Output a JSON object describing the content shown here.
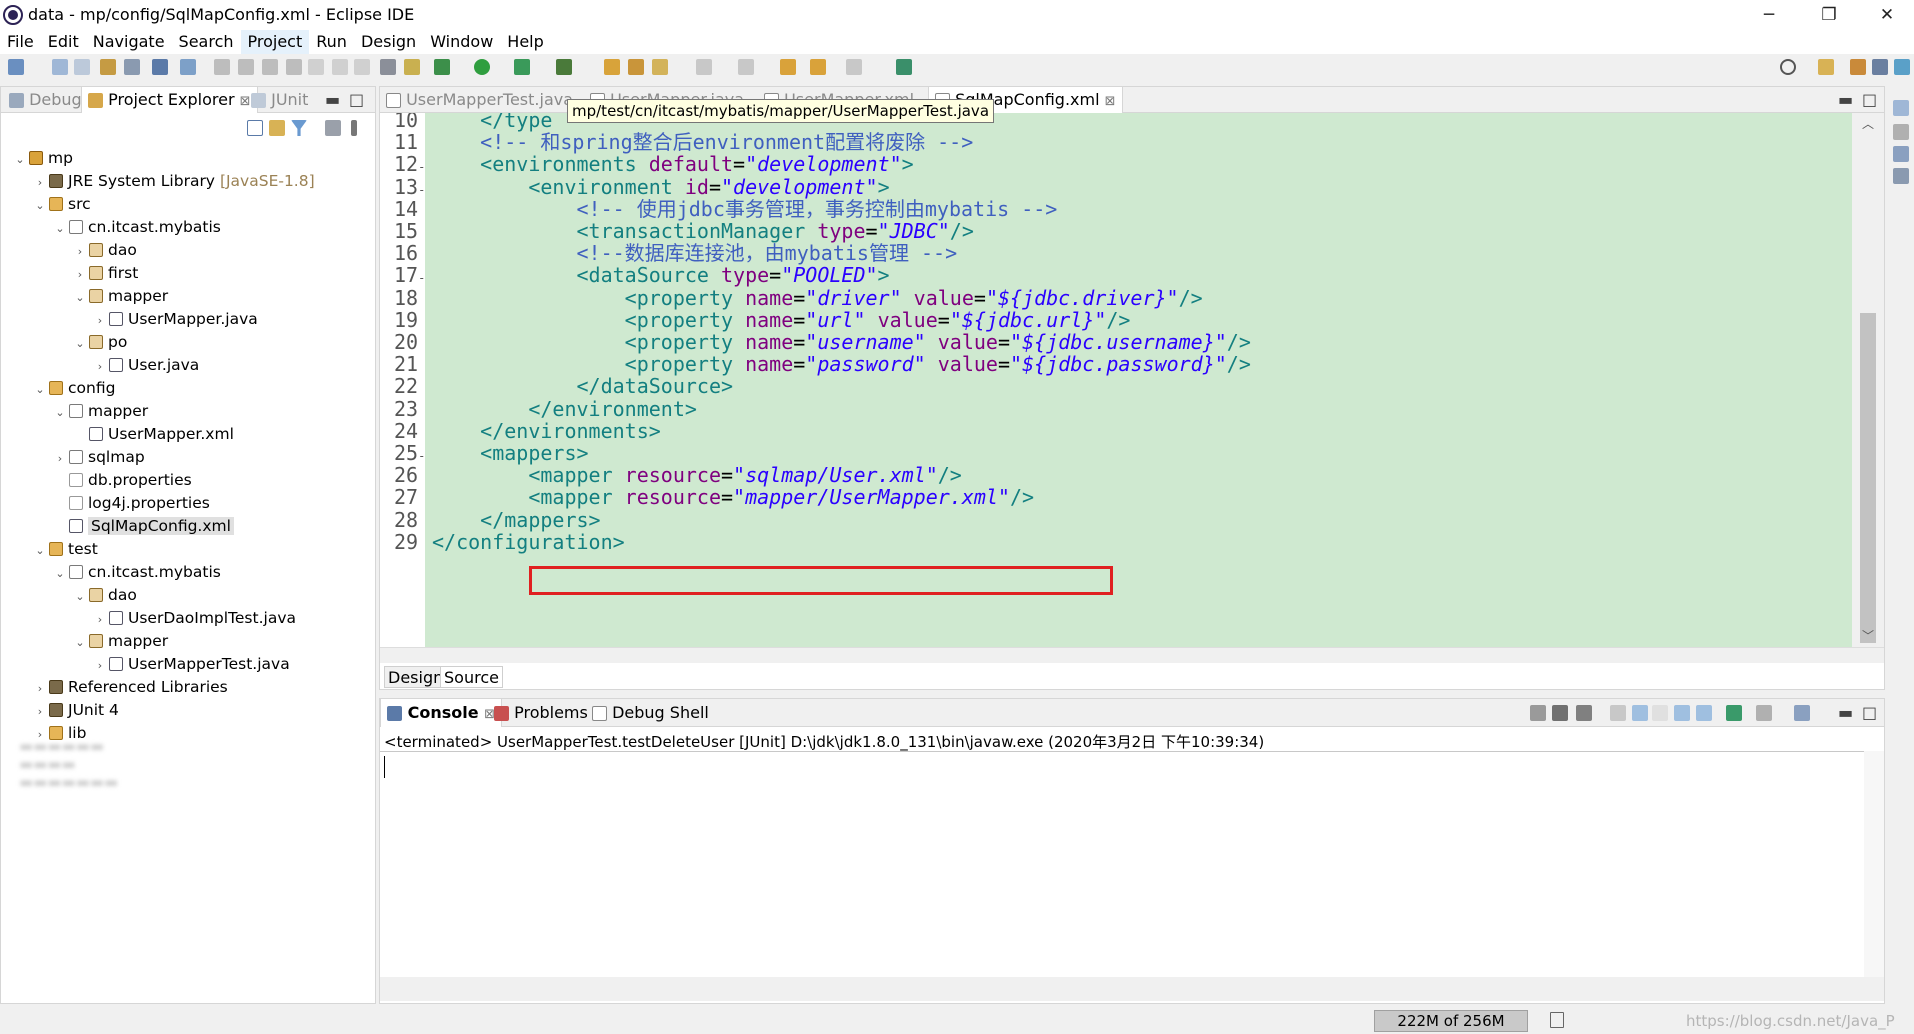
{
  "window": {
    "title": "data - mp/config/SqlMapConfig.xml - Eclipse IDE",
    "minimize": "─",
    "restore": "❐",
    "close": "✕"
  },
  "menu": [
    "File",
    "Edit",
    "Navigate",
    "Search",
    "Project",
    "Run",
    "Design",
    "Window",
    "Help"
  ],
  "left_view": {
    "tabs": {
      "debug": "Debug",
      "explorer": "Project Explorer",
      "junit": "JUnit"
    },
    "tree": [
      {
        "label": "mp",
        "sub": "",
        "depth": 0,
        "arrow": "v",
        "icon": "project-icon",
        "cls": "proj"
      },
      {
        "label": "JRE System Library",
        "sub": "[JavaSE-1.8]",
        "depth": 1,
        "arrow": ">",
        "icon": "library-icon",
        "cls": "lib"
      },
      {
        "label": "src",
        "sub": "",
        "depth": 1,
        "arrow": "v",
        "icon": "source-folder-icon",
        "cls": "src"
      },
      {
        "label": "cn.itcast.mybatis",
        "sub": "",
        "depth": 2,
        "arrow": "v",
        "icon": "package-icon",
        "cls": "pkg"
      },
      {
        "label": "dao",
        "sub": "",
        "depth": 3,
        "arrow": ">",
        "icon": "package-icon",
        "cls": "pkgc"
      },
      {
        "label": "first",
        "sub": "",
        "depth": 3,
        "arrow": ">",
        "icon": "package-icon",
        "cls": "pkgc"
      },
      {
        "label": "mapper",
        "sub": "",
        "depth": 3,
        "arrow": "v",
        "icon": "package-icon",
        "cls": "pkgc"
      },
      {
        "label": "UserMapper.java",
        "sub": "",
        "depth": 4,
        "arrow": ">",
        "icon": "java-file-icon",
        "cls": "java"
      },
      {
        "label": "po",
        "sub": "",
        "depth": 3,
        "arrow": "v",
        "icon": "package-icon",
        "cls": "pkgc"
      },
      {
        "label": "User.java",
        "sub": "",
        "depth": 4,
        "arrow": ">",
        "icon": "java-file-icon",
        "cls": "java"
      },
      {
        "label": "config",
        "sub": "",
        "depth": 1,
        "arrow": "v",
        "icon": "source-folder-icon",
        "cls": "src"
      },
      {
        "label": "mapper",
        "sub": "",
        "depth": 2,
        "arrow": "v",
        "icon": "package-icon",
        "cls": "pkg"
      },
      {
        "label": "UserMapper.xml",
        "sub": "",
        "depth": 3,
        "arrow": "",
        "icon": "xml-file-icon",
        "cls": "xml"
      },
      {
        "label": "sqlmap",
        "sub": "",
        "depth": 2,
        "arrow": ">",
        "icon": "package-icon",
        "cls": "pkg"
      },
      {
        "label": "db.properties",
        "sub": "",
        "depth": 2,
        "arrow": "",
        "icon": "file-icon",
        "cls": "file"
      },
      {
        "label": "log4j.properties",
        "sub": "",
        "depth": 2,
        "arrow": "",
        "icon": "file-icon",
        "cls": "file"
      },
      {
        "label": "SqlMapConfig.xml",
        "sub": "",
        "depth": 2,
        "arrow": "",
        "icon": "xml-file-icon",
        "cls": "xml",
        "selected": true
      },
      {
        "label": "test",
        "sub": "",
        "depth": 1,
        "arrow": "v",
        "icon": "source-folder-icon",
        "cls": "src"
      },
      {
        "label": "cn.itcast.mybatis",
        "sub": "",
        "depth": 2,
        "arrow": "v",
        "icon": "package-icon",
        "cls": "pkg"
      },
      {
        "label": "dao",
        "sub": "",
        "depth": 3,
        "arrow": "v",
        "icon": "package-icon",
        "cls": "pkgc"
      },
      {
        "label": "UserDaoImplTest.java",
        "sub": "",
        "depth": 4,
        "arrow": ">",
        "icon": "java-file-icon",
        "cls": "java"
      },
      {
        "label": "mapper",
        "sub": "",
        "depth": 3,
        "arrow": "v",
        "icon": "package-icon",
        "cls": "pkgc"
      },
      {
        "label": "UserMapperTest.java",
        "sub": "",
        "depth": 4,
        "arrow": ">",
        "icon": "java-file-icon",
        "cls": "java"
      },
      {
        "label": "Referenced Libraries",
        "sub": "",
        "depth": 1,
        "arrow": ">",
        "icon": "library-icon",
        "cls": "lib"
      },
      {
        "label": "JUnit 4",
        "sub": "",
        "depth": 1,
        "arrow": ">",
        "icon": "library-icon",
        "cls": "lib"
      },
      {
        "label": "lib",
        "sub": "",
        "depth": 1,
        "arrow": ">",
        "icon": "folder-icon",
        "cls": "src"
      }
    ]
  },
  "editor": {
    "tabs": [
      "UserMapperTest.java",
      "UserMapper.java",
      "UserMapper.xml",
      "SqlMapConfig.xml"
    ],
    "active_tab": "SqlMapConfig.xml",
    "tooltip": "mp/test/cn/itcast/mybatis/mapper/UserMapperTest.java",
    "lines": [
      {
        "n": "10",
        "fold": "",
        "segs": [
          [
            "pl",
            "    "
          ],
          [
            "tg",
            "</type"
          ]
        ]
      },
      {
        "n": "11",
        "fold": "",
        "segs": [
          [
            "pl",
            "    "
          ],
          [
            "cm",
            "<!-- 和spring整合后environment配置将废除 -->"
          ]
        ]
      },
      {
        "n": "12",
        "fold": "-",
        "segs": [
          [
            "pl",
            "    "
          ],
          [
            "tg",
            "<environments "
          ],
          [
            "at",
            "default"
          ],
          [
            "pl",
            "="
          ],
          [
            "av",
            "\"development\""
          ],
          [
            "tg",
            ">"
          ]
        ]
      },
      {
        "n": "13",
        "fold": "-",
        "segs": [
          [
            "pl",
            "        "
          ],
          [
            "tg",
            "<environment "
          ],
          [
            "at",
            "id"
          ],
          [
            "pl",
            "="
          ],
          [
            "av",
            "\"development\""
          ],
          [
            "tg",
            ">"
          ]
        ]
      },
      {
        "n": "14",
        "fold": "",
        "segs": [
          [
            "pl",
            "            "
          ],
          [
            "cm",
            "<!-- 使用jdbc事务管理，事务控制由mybatis -->"
          ]
        ]
      },
      {
        "n": "15",
        "fold": "",
        "segs": [
          [
            "pl",
            "            "
          ],
          [
            "tg",
            "<transactionManager "
          ],
          [
            "at",
            "type"
          ],
          [
            "pl",
            "="
          ],
          [
            "av",
            "\"JDBC\""
          ],
          [
            "tg",
            "/>"
          ]
        ]
      },
      {
        "n": "16",
        "fold": "",
        "segs": [
          [
            "pl",
            "            "
          ],
          [
            "cm",
            "<!--数据库连接池，由mybatis管理 -->"
          ]
        ]
      },
      {
        "n": "17",
        "fold": "-",
        "segs": [
          [
            "pl",
            "            "
          ],
          [
            "tg",
            "<dataSource "
          ],
          [
            "at",
            "type"
          ],
          [
            "pl",
            "="
          ],
          [
            "av",
            "\"POOLED\""
          ],
          [
            "tg",
            ">"
          ]
        ]
      },
      {
        "n": "18",
        "fold": "",
        "segs": [
          [
            "pl",
            "                "
          ],
          [
            "tg",
            "<property "
          ],
          [
            "at",
            "name"
          ],
          [
            "pl",
            "="
          ],
          [
            "av",
            "\"driver\""
          ],
          [
            "pl",
            " "
          ],
          [
            "at",
            "value"
          ],
          [
            "pl",
            "="
          ],
          [
            "av",
            "\"${jdbc.driver}\""
          ],
          [
            "tg",
            "/>"
          ]
        ]
      },
      {
        "n": "19",
        "fold": "",
        "segs": [
          [
            "pl",
            "                "
          ],
          [
            "tg",
            "<property "
          ],
          [
            "at",
            "name"
          ],
          [
            "pl",
            "="
          ],
          [
            "av",
            "\"url\""
          ],
          [
            "pl",
            " "
          ],
          [
            "at",
            "value"
          ],
          [
            "pl",
            "="
          ],
          [
            "av",
            "\"${jdbc.url}\""
          ],
          [
            "tg",
            "/>"
          ]
        ]
      },
      {
        "n": "20",
        "fold": "",
        "segs": [
          [
            "pl",
            "                "
          ],
          [
            "tg",
            "<property "
          ],
          [
            "at",
            "name"
          ],
          [
            "pl",
            "="
          ],
          [
            "av",
            "\"username\""
          ],
          [
            "pl",
            " "
          ],
          [
            "at",
            "value"
          ],
          [
            "pl",
            "="
          ],
          [
            "av",
            "\"${jdbc.username}\""
          ],
          [
            "tg",
            "/>"
          ]
        ]
      },
      {
        "n": "21",
        "fold": "",
        "segs": [
          [
            "pl",
            "                "
          ],
          [
            "tg",
            "<property "
          ],
          [
            "at",
            "name"
          ],
          [
            "pl",
            "="
          ],
          [
            "av",
            "\"password\""
          ],
          [
            "pl",
            " "
          ],
          [
            "at",
            "value"
          ],
          [
            "pl",
            "="
          ],
          [
            "av",
            "\"${jdbc.password}\""
          ],
          [
            "tg",
            "/>"
          ]
        ]
      },
      {
        "n": "22",
        "fold": "",
        "segs": [
          [
            "pl",
            "            "
          ],
          [
            "tg",
            "</dataSource>"
          ]
        ]
      },
      {
        "n": "23",
        "fold": "",
        "segs": [
          [
            "pl",
            "        "
          ],
          [
            "tg",
            "</environment>"
          ]
        ]
      },
      {
        "n": "24",
        "fold": "",
        "segs": [
          [
            "pl",
            "    "
          ],
          [
            "tg",
            "</environments>"
          ]
        ]
      },
      {
        "n": "25",
        "fold": "-",
        "segs": [
          [
            "pl",
            "    "
          ],
          [
            "tg",
            "<mappers>"
          ]
        ]
      },
      {
        "n": "26",
        "fold": "",
        "segs": [
          [
            "pl",
            "        "
          ],
          [
            "tg",
            "<mapper "
          ],
          [
            "at",
            "resource"
          ],
          [
            "pl",
            "="
          ],
          [
            "av",
            "\"sqlmap/User.xml\""
          ],
          [
            "tg",
            "/>"
          ]
        ]
      },
      {
        "n": "27",
        "fold": "",
        "segs": [
          [
            "pl",
            "        "
          ],
          [
            "tg",
            "<mapper "
          ],
          [
            "at",
            "resource"
          ],
          [
            "pl",
            "="
          ],
          [
            "av",
            "\"mapper/UserMapper.xml\""
          ],
          [
            "tg",
            "/>"
          ]
        ]
      },
      {
        "n": "28",
        "fold": "",
        "segs": [
          [
            "pl",
            "    "
          ],
          [
            "tg",
            "</mappers>"
          ]
        ]
      },
      {
        "n": "29",
        "fold": "",
        "segs": [
          [
            "tg",
            "</configuration>"
          ]
        ]
      }
    ],
    "mode_tabs": {
      "design": "Design",
      "source": "Source"
    }
  },
  "console": {
    "tabs": {
      "console": "Console",
      "problems": "Problems",
      "debug_shell": "Debug Shell"
    },
    "terminated": "<terminated> UserMapperTest.testDeleteUser [JUnit] D:\\jdk\\jdk1.8.0_131\\bin\\javaw.exe (2020年3月2日 下午10:39:34)"
  },
  "status": {
    "heap": "222M of 256M",
    "watermark": "https://blog.csdn.net/Java_P"
  },
  "colors": {
    "editor_bg": "#cfe9d0",
    "tag": "#137f80",
    "attr": "#7f007f",
    "value": "#2a00ff",
    "comment": "#3f5fbf",
    "highlight_box": "#e02020"
  }
}
